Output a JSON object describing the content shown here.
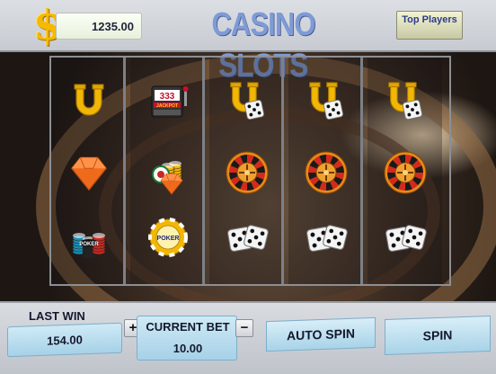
{
  "header": {
    "currency_symbol": "$",
    "balance": "1235.00",
    "title": "CASINO SLOTS",
    "top_players_label": "Top Players"
  },
  "reels": [
    [
      "horseshoe",
      "gem",
      "poker-chips"
    ],
    [
      "slot-machine",
      "chips-stack-gem",
      "poker-chip"
    ],
    [
      "horseshoe-dice",
      "roulette-wheel",
      "dice"
    ],
    [
      "horseshoe-dice",
      "roulette-wheel",
      "dice"
    ],
    [
      "horseshoe-dice",
      "roulette-wheel",
      "dice"
    ]
  ],
  "symbol_text": {
    "slot_machine_digits": "333",
    "slot_machine_label": "JACKPOT",
    "poker_chip_label": "POKER"
  },
  "footer": {
    "last_win_label": "LAST WIN",
    "last_win_value": "154.00",
    "plus_label": "+",
    "current_bet_label": "CURRENT BET",
    "minus_label": "−",
    "current_bet_value": "10.00",
    "auto_spin_label": "AUTO SPIN",
    "spin_label": "SPIN"
  },
  "colors": {
    "title": "#7f9bd6",
    "button_fill": "#a8d3e8",
    "gold": "#f6b800"
  }
}
